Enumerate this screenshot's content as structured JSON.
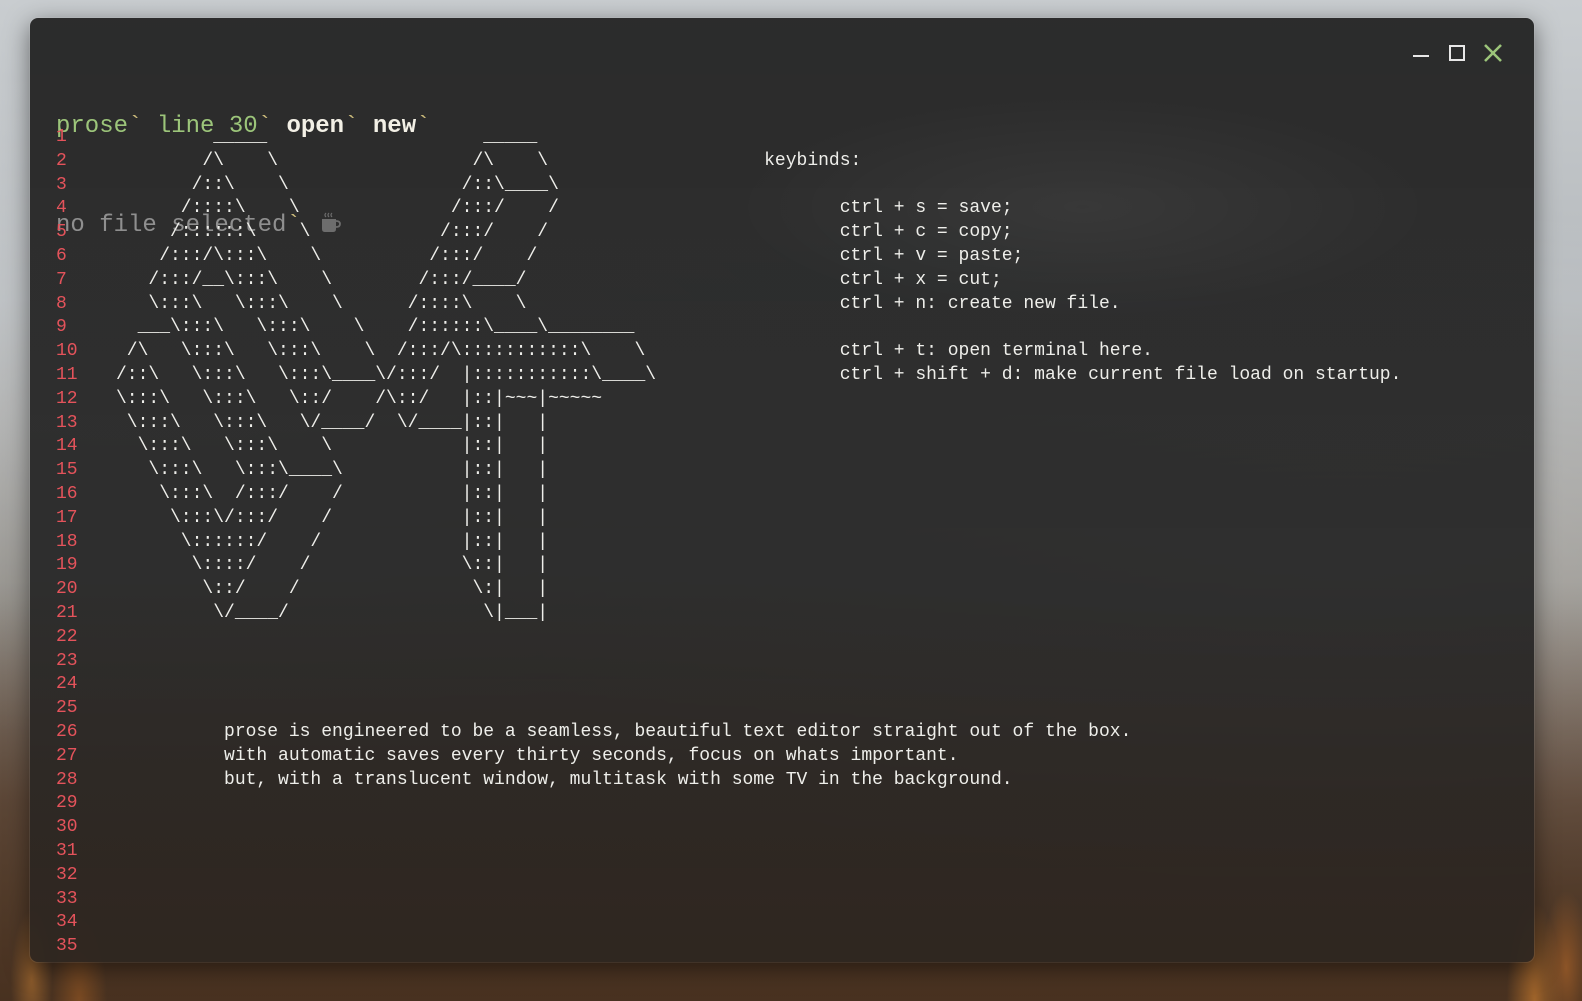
{
  "topbar": {
    "app_name": "prose",
    "line_label": "line 30",
    "open_label": "open",
    "new_label": "new",
    "tick": "`",
    "file_status": "no file selected",
    "status_icon": "mug-icon"
  },
  "window_controls": {
    "minimize_icon": "minimize-icon",
    "maximize_icon": "maximize-icon",
    "close_icon": "close-icon",
    "close_color": "#9cc57a"
  },
  "colors": {
    "accent_green": "#9cc57a",
    "line_number_red": "#e4535b",
    "text": "#eeeeea"
  },
  "editor": {
    "line_numbers": [
      "1",
      "2",
      "3",
      "4",
      "5",
      "6",
      "7",
      "8",
      "9",
      "10",
      "11",
      "12",
      "13",
      "14",
      "15",
      "16",
      "17",
      "18",
      "19",
      "20",
      "21",
      "22",
      "23",
      "24",
      "25",
      "26",
      "27",
      "28",
      "29",
      "30",
      "31",
      "32",
      "33",
      "34",
      "35"
    ],
    "lines": [
      "         _____                    _____",
      "        /\\    \\                  /\\    \\                    keybinds:",
      "       /::\\    \\                /::\\____\\",
      "      /::::\\    \\              /:::/    /                          ctrl + s = save;",
      "     /::::::\\    \\            /:::/    /                           ctrl + c = copy;",
      "    /:::/\\:::\\    \\          /:::/    /                            ctrl + v = paste;",
      "   /:::/__\\:::\\    \\        /:::/____/                             ctrl + x = cut;",
      "   \\:::\\   \\:::\\    \\      /::::\\    \\                             ctrl + n: create new file.",
      "  ___\\:::\\   \\:::\\    \\    /::::::\\____\\________",
      " /\\   \\:::\\   \\:::\\    \\  /:::/\\:::::::::::\\    \\                  ctrl + t: open terminal here.",
      "/::\\   \\:::\\   \\:::\\____\\/:::/  |:::::::::::\\____\\                 ctrl + shift + d: make current file load on startup.",
      "\\:::\\   \\:::\\   \\::/    /\\::/   |::|~~~|~~~~~",
      " \\:::\\   \\:::\\   \\/____/  \\/____|::|   |",
      "  \\:::\\   \\:::\\    \\            |::|   |",
      "   \\:::\\   \\:::\\____\\           |::|   |",
      "    \\:::\\  /:::/    /           |::|   |",
      "     \\:::\\/:::/    /            |::|   |",
      "      \\::::::/    /             |::|   |",
      "       \\::::/    /              \\::|   |",
      "        \\::/    /                \\:|   |",
      "         \\/____/                  \\|___|",
      "",
      "",
      "",
      "",
      "          prose is engineered to be a seamless, beautiful text editor straight out of the box.",
      "          with automatic saves every thirty seconds, focus on whats important.",
      "          but, with a translucent window, multitask with some TV in the background.",
      "",
      "",
      "",
      "",
      "",
      "",
      ""
    ]
  }
}
